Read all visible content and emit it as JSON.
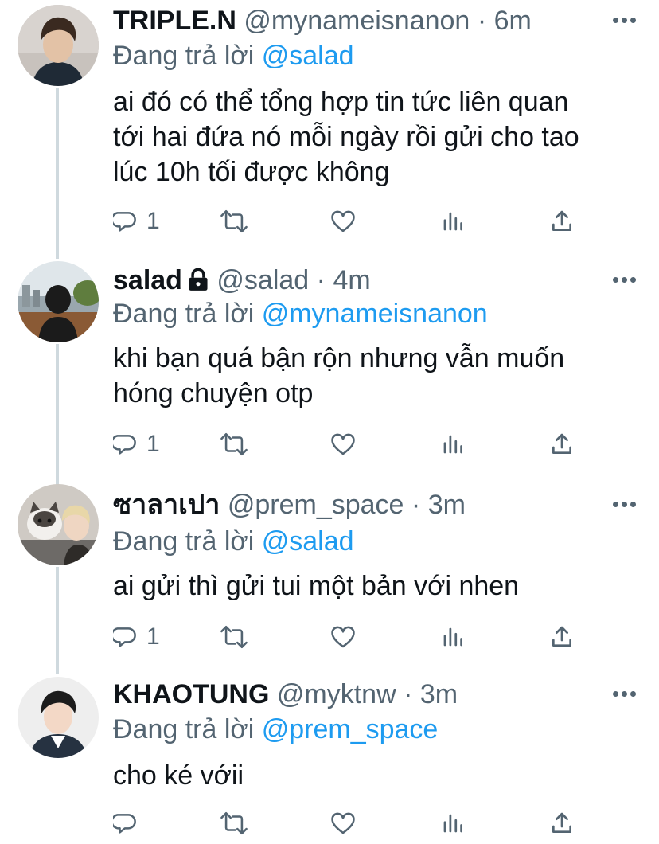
{
  "tweets": [
    {
      "name": "TRIPLE.N",
      "handle": "@mynameisnanon",
      "dot": "·",
      "time": "6m",
      "replying_label": "Đang trả lời",
      "replying_to": "@salad",
      "text_lines": [
        "ai đó có thể tổng hợp tin tức liên quan",
        "tới hai đứa nó mỗi ngày rồi gửi cho tao",
        "lúc 10h tối được không"
      ],
      "reply_count": "1",
      "locked": false
    },
    {
      "name": "salad",
      "handle": "@salad",
      "dot": "·",
      "time": "4m",
      "replying_label": "Đang trả lời",
      "replying_to": "@mynameisnanon",
      "text_lines": [
        "khi bạn quá bận rộn nhưng vẫn muốn",
        "hóng chuyện otp"
      ],
      "reply_count": "1",
      "locked": true
    },
    {
      "name": "ซาลาเปา",
      "handle": "@prem_space",
      "dot": "·",
      "time": "3m",
      "replying_label": "Đang trả lời",
      "replying_to": "@salad",
      "text_lines": [
        "ai gửi thì gửi tui một bản với nhen"
      ],
      "reply_count": "1",
      "locked": false
    },
    {
      "name": "KHAOTUNG",
      "handle": "@myktnw",
      "dot": "·",
      "time": "3m",
      "replying_label": "Đang trả lời",
      "replying_to": "@prem_space",
      "text_lines": [
        "cho ké vớii"
      ],
      "reply_count": "",
      "locked": false
    }
  ],
  "colors": {
    "text": "#0f1419",
    "secondary": "#536471",
    "link": "#1d9bf0",
    "connector": "#cfd9de"
  },
  "icons": [
    "reply-icon",
    "retweet-icon",
    "like-icon",
    "analytics-icon",
    "share-icon",
    "more-icon",
    "lock-icon"
  ]
}
